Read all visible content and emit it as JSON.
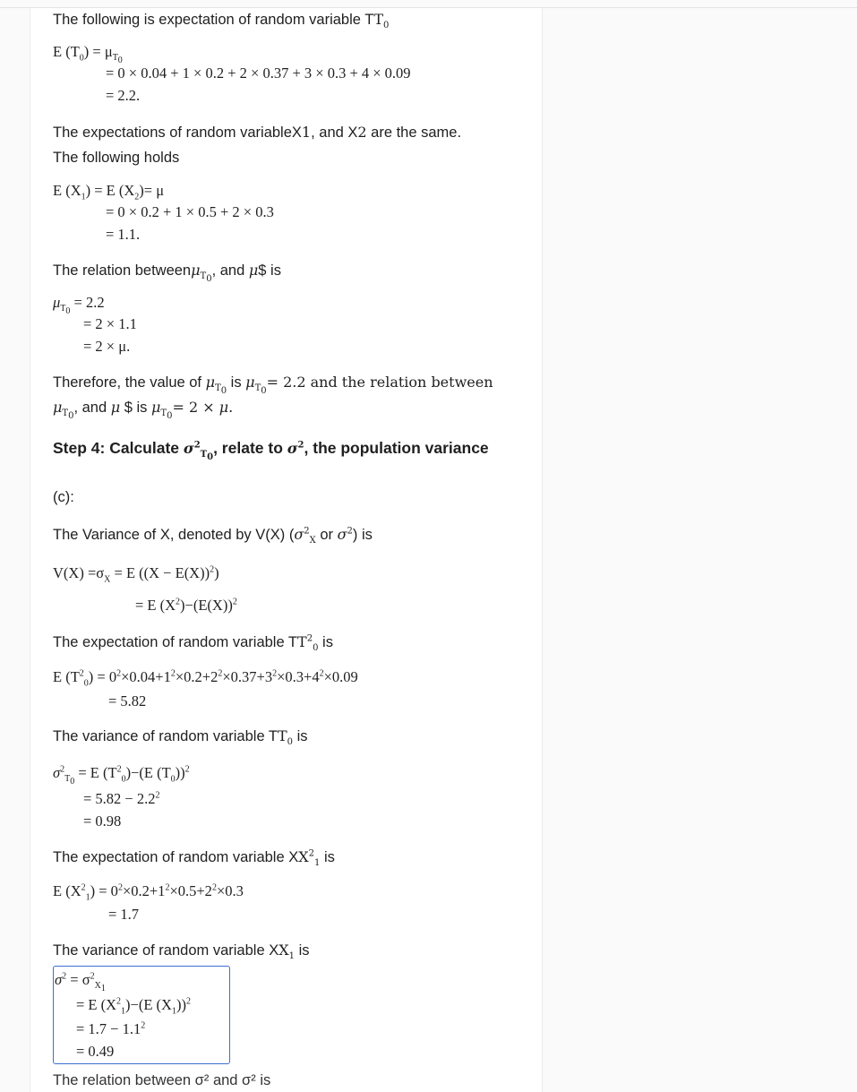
{
  "texts": {
    "t1": "The following is expectation of random variable T",
    "t2": "The expectations of random variableX",
    "t2b": ", and X",
    "t2c": " are the same.",
    "t3": "The following holds",
    "t4": "The relation between",
    "t4b": ", and ",
    "t4c": "$ is",
    "t5a": "Therefore, the value of ",
    "t5b": " is ",
    "t5c": "= 2.2 and the relation between",
    "t6a": ", and ",
    "t6b": " $ is ",
    "t6c": "= 2 × ",
    "step4a": "Step 4: Calculate ",
    "step4b": ", relate to ",
    "step4c": ", the population variance",
    "c_label": "(c):",
    "t7a": "The Variance of X, denoted by V(X) (",
    "t7b": " or ",
    "t7c": ") is",
    "t8": "The expectation of random variable T",
    "t9": "The variance of random variable T",
    "t10": "The expectation of random variable X",
    "t11": "The variance of random variable X",
    "is": " is",
    "cut": "The relation between σ² and σ² is"
  },
  "math": {
    "e_t0_1": "E (T",
    "e_t0_1b": ") = μ",
    "e_t0_2": "= 0 × 0.04 + 1 × 0.2 + 2 × 0.37 + 3 × 0.3 + 4 × 0.09",
    "e_t0_3": "= 2.2.",
    "e_x_1": "E (X",
    "e_x_1b": ") = E (X",
    "e_x_1c": ")= μ",
    "e_x_2": "= 0 × 0.2 + 1 × 0.5 + 2 × 0.3",
    "e_x_3": "= 1.1.",
    "rel_1": "= 2.2",
    "rel_2": "= 2 × 1.1",
    "rel_3": "= 2 × μ.",
    "var_1": "V(X) =σ",
    "var_1b": " = E ((X − E(X))",
    "var_1c": ")",
    "var_2": "= E (X",
    "var_2b": ")−(E(X))",
    "et2_1": "E (T",
    "et2_1b": ") = 0",
    "et2_1c": "×0.04+1",
    "et2_1d": "×0.2+2",
    "et2_1e": "×0.37+3",
    "et2_1f": "×0.3+4",
    "et2_1g": "×0.09",
    "et2_2": "= 5.82",
    "vt0_1": " = E (T",
    "vt0_1b": ")−(E (T",
    "vt0_1c": "))",
    "vt0_2": "= 5.82 − 2.2",
    "vt0_3": "= 0.98",
    "ex2_1": "E (X",
    "ex2_1b": ") = 0",
    "ex2_1c": "×0.2+1",
    "ex2_1d": "×0.5+2",
    "ex2_1e": "×0.3",
    "ex2_2": "= 1.7",
    "vx_1": " = σ",
    "vx_2": "= E (X",
    "vx_2b": ")−(E (X",
    "vx_2c": "))",
    "vx_3": "= 1.7 − 1.1",
    "vx_4": "= 0.49"
  },
  "colors": {
    "highlight_border": "#3b6fd1",
    "card_bg": "#ffffff",
    "page_bg": "#fafafb"
  }
}
